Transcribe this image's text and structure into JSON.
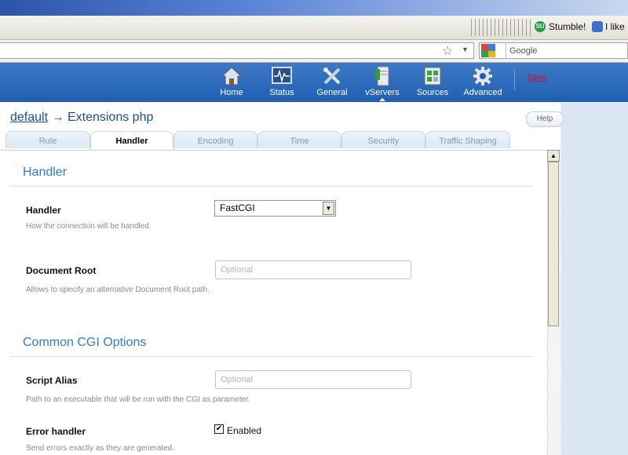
{
  "browser": {
    "stumble_label": "Stumble!",
    "like_label": "I like",
    "search_placeholder": "Google"
  },
  "nav": {
    "items": [
      {
        "label": "Home",
        "icon": "home-icon"
      },
      {
        "label": "Status",
        "icon": "status-monitor-icon"
      },
      {
        "label": "General",
        "icon": "tools-icon"
      },
      {
        "label": "vServers",
        "icon": "server-icon"
      },
      {
        "label": "Sources",
        "icon": "sources-icon"
      },
      {
        "label": "Advanced",
        "icon": "gear-icon"
      }
    ],
    "save_label": "Save"
  },
  "breadcrumb": {
    "root": "default",
    "arrow": "→",
    "current": "Extensions php"
  },
  "help_label": "Help",
  "tabs": [
    {
      "label": "Rule",
      "active": false
    },
    {
      "label": "Handler",
      "active": true
    },
    {
      "label": "Encoding",
      "active": false
    },
    {
      "label": "Time",
      "active": false
    },
    {
      "label": "Security",
      "active": false
    },
    {
      "label": "Traffic Shaping",
      "active": false
    }
  ],
  "sections": {
    "handler_title": "Handler",
    "cgi_title": "Common CGI Options"
  },
  "fields": {
    "handler": {
      "label": "Handler",
      "value": "FastCGI",
      "hint": "How the connection will be handled."
    },
    "document_root": {
      "label": "Document Root",
      "placeholder": "Optional",
      "hint": "Allows to specify an alternative Document Root path."
    },
    "script_alias": {
      "label": "Script Alias",
      "placeholder": "Optional",
      "hint": "Path to an executable that will be run with the CGI as parameter."
    },
    "error_handler": {
      "label": "Error handler",
      "checkbox_label": "Enabled",
      "checked": true,
      "hint": "Send errors exactly as they are generated."
    }
  },
  "colors": {
    "header_blue": "#1f5fb3",
    "title_blue": "#2f7bd0",
    "save_red": "#c8142a"
  }
}
